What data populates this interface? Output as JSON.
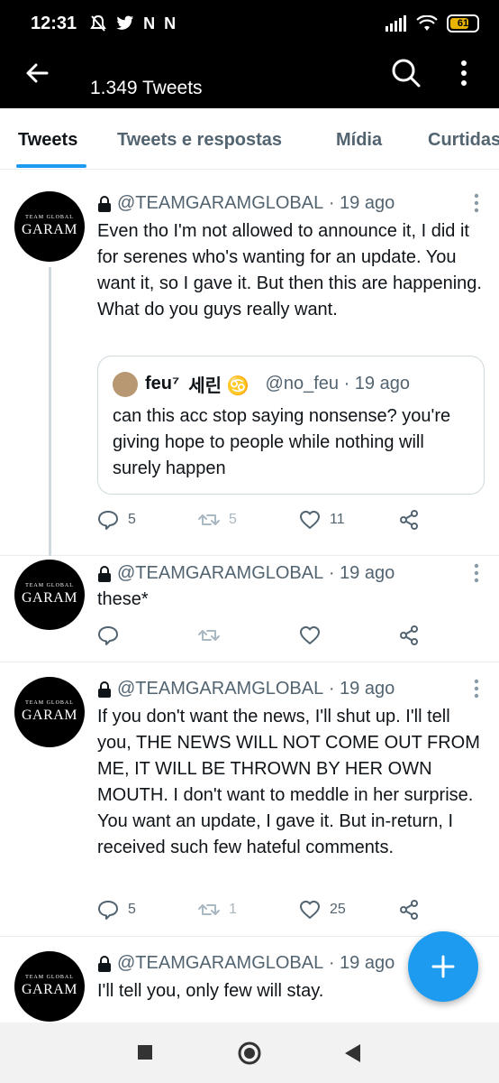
{
  "status_bar": {
    "time": "12:31",
    "notification_icons": [
      "mute-icon",
      "twitter-bird-icon",
      "N",
      "N"
    ],
    "battery_level": "61",
    "battery_color": "#e8b400"
  },
  "header": {
    "tweet_count": "1.349 Tweets"
  },
  "tabs": [
    {
      "label": "Tweets",
      "active": true
    },
    {
      "label": "Tweets e respostas",
      "active": false
    },
    {
      "label": "Mídia",
      "active": false
    },
    {
      "label": "Curtidas",
      "active": false
    }
  ],
  "avatar": {
    "small_text": "TEAM GLOBAL",
    "big_text": "GARAM"
  },
  "tweets": [
    {
      "handle": "@TEAMGARAMGLOBAL",
      "time": "· 19 ago",
      "text": "Even tho I'm not allowed to announce it, I did it for serenes who's wanting for an update. You want it, so I gave it. But then this are happening. What do you guys really want.",
      "quote": {
        "name": "feu⁷",
        "name_extra": "세린 ♋",
        "handle": "@no_feu · 19 ago",
        "text": "can this acc stop saying nonsense? you're giving hope to people while nothing will surely happen"
      },
      "replies": "5",
      "retweets": "5",
      "likes": "11"
    },
    {
      "handle": "@TEAMGARAMGLOBAL",
      "time": "· 19 ago",
      "text": "these*",
      "replies": "",
      "retweets": "",
      "likes": ""
    },
    {
      "handle": "@TEAMGARAMGLOBAL",
      "time": "· 19 ago",
      "text": "If you don't want the news, I'll shut up. I'll tell you, THE NEWS WILL NOT COME OUT FROM ME, IT WILL BE THROWN BY HER OWN MOUTH. I don't want to meddle in her surprise. You want an update, I gave it. But in-return, I received such few hateful comments.",
      "replies": "5",
      "retweets": "1",
      "likes": "25"
    },
    {
      "handle": "@TEAMGARAMGLOBAL",
      "time": "· 19 ago",
      "text": "I'll tell you, only few will stay."
    }
  ],
  "colors": {
    "accent": "#1d9bf0",
    "secondary_text": "#536471",
    "divider": "#e6ecf0"
  }
}
